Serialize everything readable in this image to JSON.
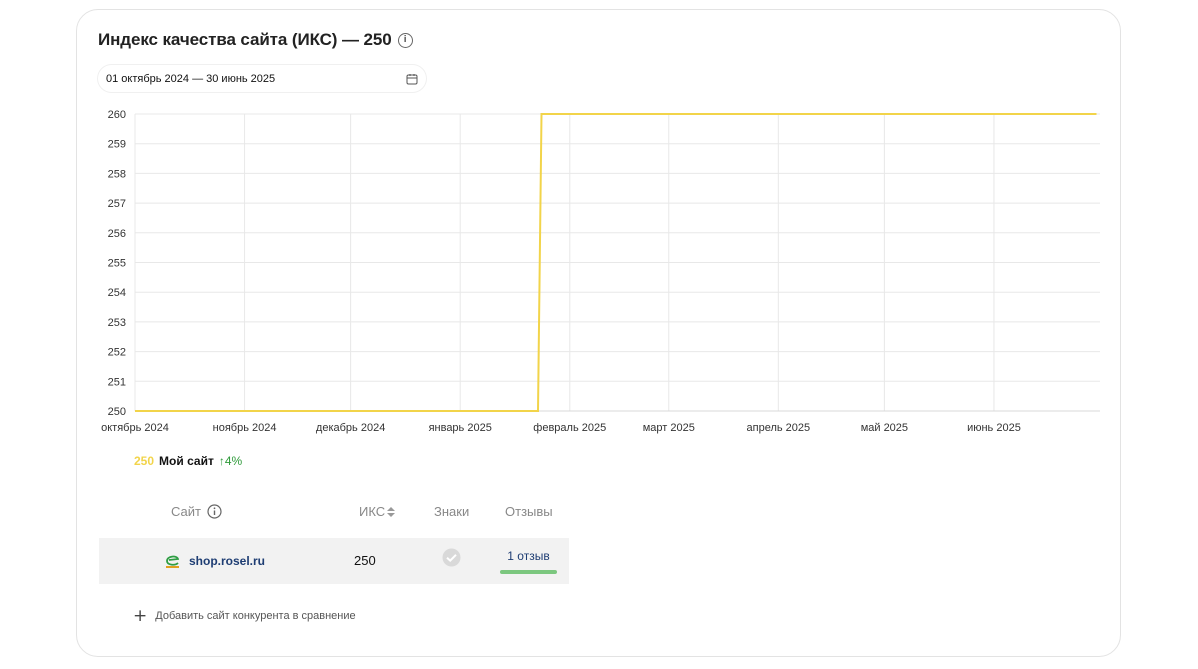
{
  "header": {
    "title": "Индекс качества сайта (ИКС) — 250",
    "info_icon": "i"
  },
  "date_range": {
    "label": "01 октябрь 2024 — 30 июнь 2025"
  },
  "chart_data": {
    "type": "line",
    "y_ticks": [
      "260",
      "259",
      "258",
      "257",
      "256",
      "255",
      "254",
      "253",
      "252",
      "251",
      "250"
    ],
    "ylim": [
      250,
      260
    ],
    "x_ticks": [
      "октябрь 2024",
      "ноябрь 2024",
      "декабрь 2024",
      "январь 2025",
      "февраль 2025",
      "март 2025",
      "апрель 2025",
      "май 2025",
      "июнь 2025"
    ],
    "x_range": [
      "2024-10-01",
      "2025-06-30"
    ],
    "grid": true,
    "series": [
      {
        "name": "Мой сайт",
        "color": "#f2d44a",
        "points": [
          {
            "date": "2024-10-01",
            "value": 250
          },
          {
            "date": "2025-01-23",
            "value": 250
          },
          {
            "date": "2025-01-24",
            "value": 260
          },
          {
            "date": "2025-06-30",
            "value": 260
          }
        ]
      }
    ]
  },
  "legend": {
    "value": "250",
    "name": "Мой сайт",
    "delta": "↑4%"
  },
  "table": {
    "headers": {
      "site": "Сайт",
      "iks": "ИКС",
      "badges": "Знаки",
      "reviews": "Отзывы"
    },
    "rows": [
      {
        "site": "shop.rosel.ru",
        "iks": "250",
        "reviews": "1 отзыв"
      }
    ]
  },
  "add_competitor": {
    "label": "Добавить сайт конкурента в сравнение"
  }
}
